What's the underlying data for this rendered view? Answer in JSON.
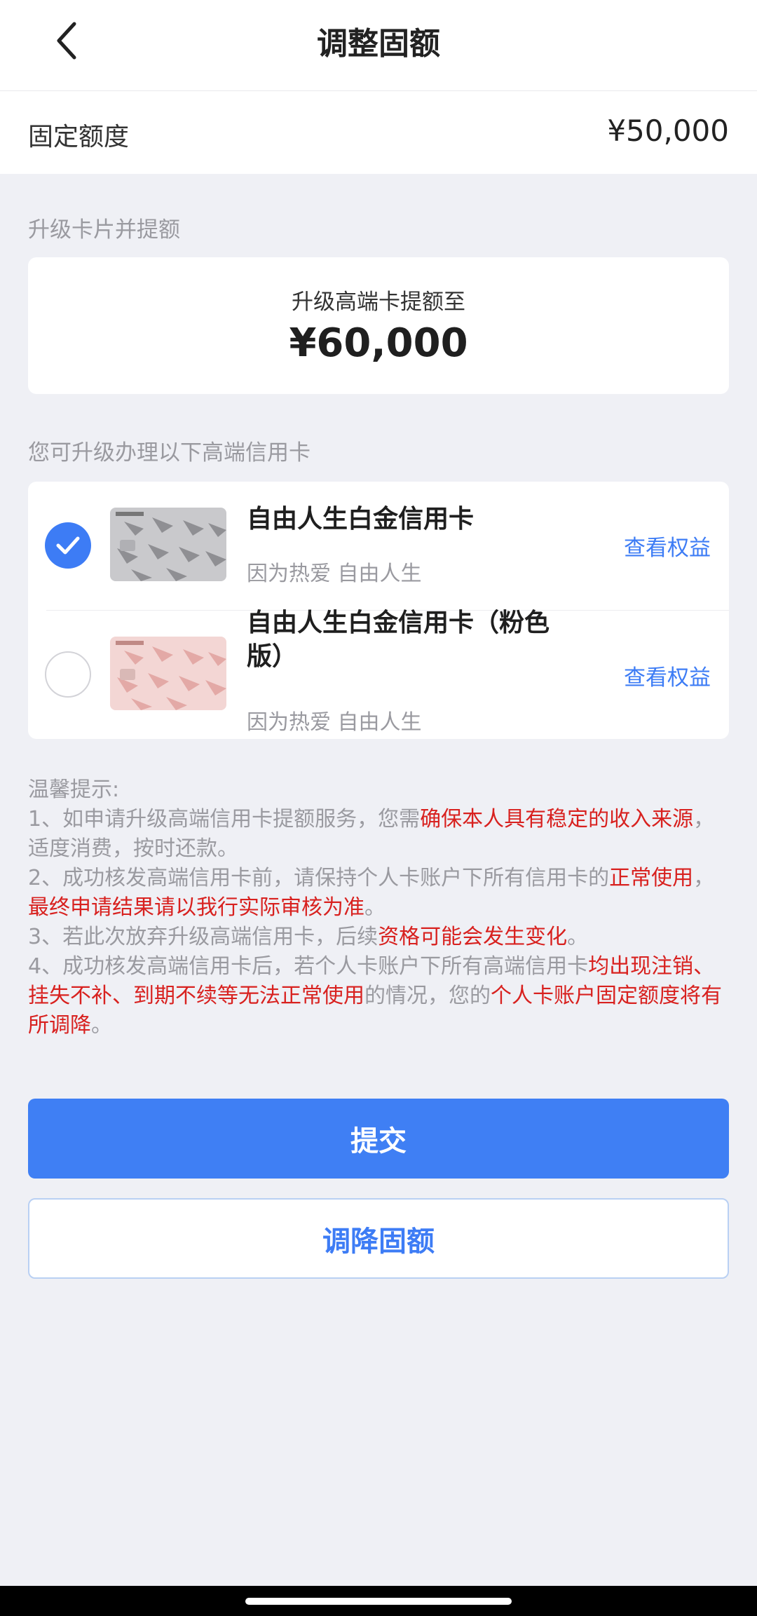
{
  "navbar": {
    "title": "调整固额",
    "back_icon": "chevron-left-icon"
  },
  "fixed_limit": {
    "label": "固定额度",
    "value": "¥50,000"
  },
  "upgrade_section": {
    "label": "升级卡片并提额",
    "subtitle": "升级高端卡提额至",
    "amount": "¥60,000"
  },
  "cards_section": {
    "label": "您可升级办理以下高端信用卡",
    "cards": [
      {
        "name": "自由人生白金信用卡",
        "slogan": "因为热爱 自由人生",
        "link": "查看权益",
        "selected": true
      },
      {
        "name": "自由人生白金信用卡（粉色版）",
        "slogan": "因为热爱 自由人生",
        "link": "查看权益",
        "selected": false
      }
    ]
  },
  "tips": {
    "title": "温馨提示:",
    "t1a": "1、如申请升级高端信用卡提额服务，您需",
    "t1b": "确保本人具有稳定的收入来源",
    "t1c": "，适度消费，按时还款。",
    "t2a": "2、成功核发高端信用卡前，请保持个人卡账户下所有信用卡的",
    "t2b": "正常使用",
    "t2c": "，",
    "t2d": "最终申请结果请以我行实际审核为准",
    "t2e": "。",
    "t3a": "3、若此次放弃升级高端信用卡，后续",
    "t3b": "资格可能会发生变化",
    "t3c": "。",
    "t4a": "4、成功核发高端信用卡后，若个人卡账户下所有高端信用卡",
    "t4b": "均出现注销、挂失不补、到期不续等无法正常使用",
    "t4c": "的情况，您的",
    "t4d": "个人卡账户固定额度将有所调降",
    "t4e": "。"
  },
  "buttons": {
    "submit": "提交",
    "lower": "调降固额"
  },
  "colors": {
    "primary": "#3f7ff4",
    "highlight": "#d8211f",
    "muted": "#9a9aa0",
    "background": "#eff0f5"
  }
}
